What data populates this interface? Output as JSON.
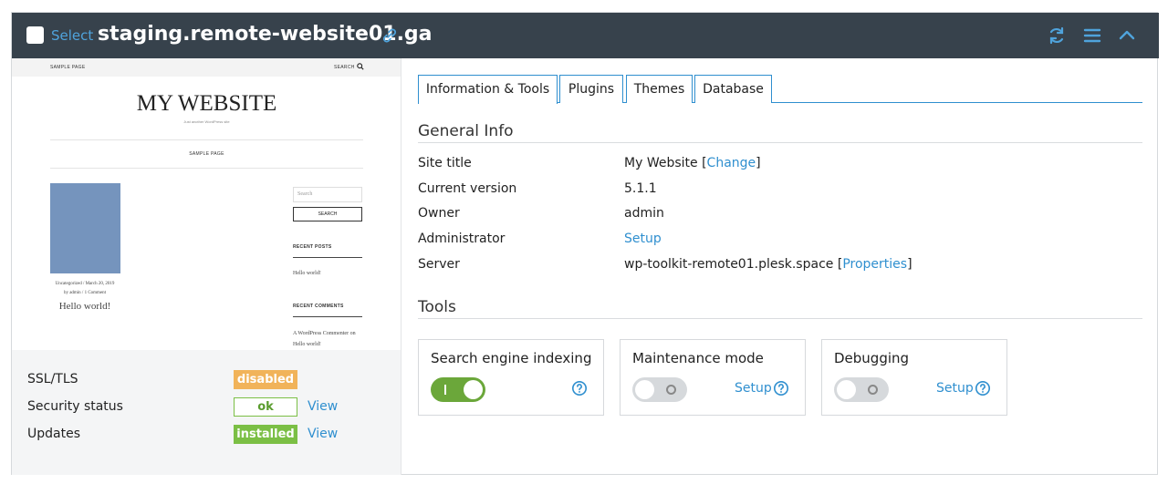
{
  "header": {
    "select_label": "Select",
    "site_name": "staging.remote-website01.ga"
  },
  "preview": {
    "nav_left": "SAMPLE PAGE",
    "nav_right": "SEARCH",
    "site_title": "MY WEBSITE",
    "tagline": "Just another WordPress site",
    "menu_item": "SAMPLE PAGE",
    "post_meta_1": "Uncategorized / March 20, 2019",
    "post_meta_2": "by admin / 1 Comment",
    "post_title": "Hello world!",
    "search_placeholder": "Search",
    "search_button": "SEARCH",
    "recent_posts_heading": "RECENT POSTS",
    "recent_post_1": "Hello world!",
    "recent_comments_heading": "RECENT COMMENTS",
    "recent_comment_1": "A WordPress Commenter on",
    "recent_comment_2": "Hello world!"
  },
  "status": {
    "ssl_label": "SSL/TLS",
    "ssl_badge": "disabled",
    "security_label": "Security status",
    "security_badge": "ok",
    "security_link": "View",
    "updates_label": "Updates",
    "updates_badge": "installed",
    "updates_link": "View"
  },
  "tabs": [
    {
      "label": "Information & Tools",
      "active": true
    },
    {
      "label": "Plugins",
      "active": false
    },
    {
      "label": "Themes",
      "active": false
    },
    {
      "label": "Database",
      "active": false
    }
  ],
  "general_info": {
    "title": "General Info",
    "site_title_label": "Site title",
    "site_title_value": "My Website",
    "change_link": "Change",
    "version_label": "Current version",
    "version_value": "5.1.1",
    "owner_label": "Owner",
    "owner_value": "admin",
    "admin_label": "Administrator",
    "admin_link": "Setup",
    "server_label": "Server",
    "server_value": "wp-toolkit-remote01.plesk.space",
    "properties_link": "Properties",
    "bracket_open": "[",
    "bracket_close": "]"
  },
  "tools": {
    "title": "Tools",
    "items": [
      {
        "label": "Search engine indexing",
        "enabled": true,
        "setup": ""
      },
      {
        "label": "Maintenance mode",
        "enabled": false,
        "setup": "Setup"
      },
      {
        "label": "Debugging",
        "enabled": false,
        "setup": "Setup"
      }
    ]
  },
  "colors": {
    "header_bg": "#37424c",
    "accent": "#2f8fcf",
    "success": "#7bbf45",
    "warning": "#f1b35a"
  },
  "icons": {
    "header_link": "link-icon",
    "refresh": "refresh-icon",
    "menu": "hamburger-menu-icon",
    "collapse": "chevron-up-icon",
    "help": "help-circle-icon"
  }
}
